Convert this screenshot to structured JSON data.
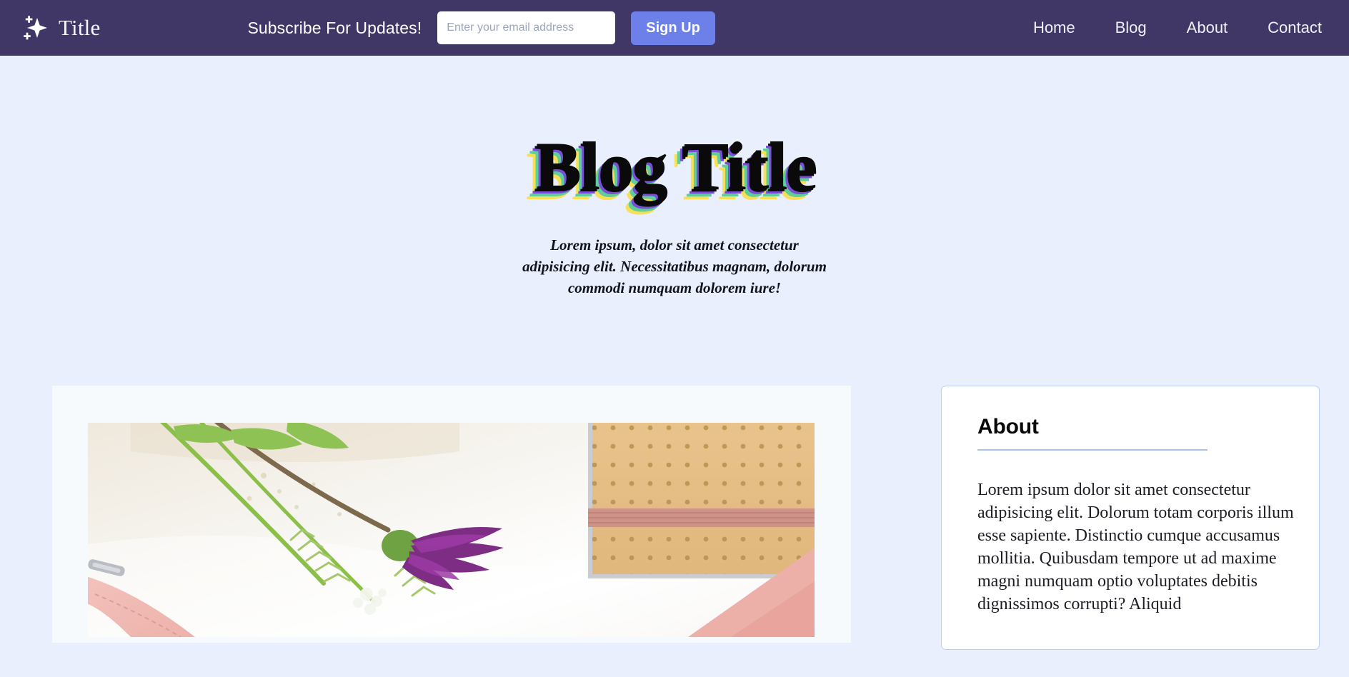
{
  "header": {
    "brand": {
      "icon": "sparkle-icon",
      "title": "Title"
    },
    "subscribe": {
      "label": "Subscribe For Updates!",
      "email_placeholder": "Enter your email address",
      "email_value": "",
      "signup_label": "Sign Up"
    },
    "nav": [
      {
        "label": "Home"
      },
      {
        "label": "Blog"
      },
      {
        "label": "About"
      },
      {
        "label": "Contact"
      }
    ],
    "colors": {
      "background": "#403767",
      "signup_button": "#6d7fe8",
      "text": "#eef0f8"
    }
  },
  "hero": {
    "title": "Blog Title",
    "subtitle": "Lorem ipsum, dolor sit amet consectetur adipisicing elit. Necessitatibus magnam, dolorum commodi numquam dolorem iure!",
    "shadow_colors": {
      "black": "#0a0a0a",
      "purple": "#7a4fd6",
      "green": "#5fcf9a",
      "yellow": "#f7df58"
    }
  },
  "main": {
    "post_card": {
      "image_alt": "flat-lay-photo-purple-flower-notebook",
      "background": "#f7fafd"
    },
    "about_card": {
      "heading": "About",
      "body": "Lorem ipsum dolor sit amet consectetur adipisicing elit. Dolorum totam corporis illum esse sapiente. Distinctio cumque accusamus mollitia. Quibusdam tempore ut ad maxime magni numquam optio voluptates debitis dignissimos corrupti? Aliquid",
      "border_color": "#bcd0f5",
      "rule_color": "#aac2f0"
    }
  },
  "page": {
    "background": "#e9effc"
  }
}
